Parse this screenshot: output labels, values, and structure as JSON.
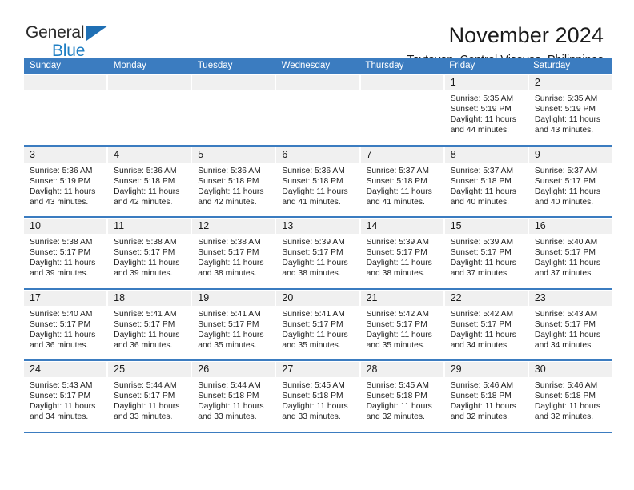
{
  "logo": {
    "word_one": "General",
    "word_two": "Blue",
    "triangle_color": "#1f6fb4",
    "blue_color": "#1f7fc4"
  },
  "header": {
    "month_title": "November 2024",
    "location": "Taytayan, Central Visayas, Philippines"
  },
  "theme": {
    "header_blue": "#3b7cc0",
    "day_band_gray": "#f0f0f0",
    "text_color": "#1a1a1a"
  },
  "weekdays": [
    "Sunday",
    "Monday",
    "Tuesday",
    "Wednesday",
    "Thursday",
    "Friday",
    "Saturday"
  ],
  "weeks": [
    [
      {
        "day": "",
        "sunrise": "",
        "sunset": "",
        "daylight_a": "",
        "daylight_b": "",
        "empty": true
      },
      {
        "day": "",
        "sunrise": "",
        "sunset": "",
        "daylight_a": "",
        "daylight_b": "",
        "empty": true
      },
      {
        "day": "",
        "sunrise": "",
        "sunset": "",
        "daylight_a": "",
        "daylight_b": "",
        "empty": true
      },
      {
        "day": "",
        "sunrise": "",
        "sunset": "",
        "daylight_a": "",
        "daylight_b": "",
        "empty": true
      },
      {
        "day": "",
        "sunrise": "",
        "sunset": "",
        "daylight_a": "",
        "daylight_b": "",
        "empty": true
      },
      {
        "day": "1",
        "sunrise": "Sunrise: 5:35 AM",
        "sunset": "Sunset: 5:19 PM",
        "daylight_a": "Daylight: 11 hours",
        "daylight_b": "and 44 minutes."
      },
      {
        "day": "2",
        "sunrise": "Sunrise: 5:35 AM",
        "sunset": "Sunset: 5:19 PM",
        "daylight_a": "Daylight: 11 hours",
        "daylight_b": "and 43 minutes."
      }
    ],
    [
      {
        "day": "3",
        "sunrise": "Sunrise: 5:36 AM",
        "sunset": "Sunset: 5:19 PM",
        "daylight_a": "Daylight: 11 hours",
        "daylight_b": "and 43 minutes."
      },
      {
        "day": "4",
        "sunrise": "Sunrise: 5:36 AM",
        "sunset": "Sunset: 5:18 PM",
        "daylight_a": "Daylight: 11 hours",
        "daylight_b": "and 42 minutes."
      },
      {
        "day": "5",
        "sunrise": "Sunrise: 5:36 AM",
        "sunset": "Sunset: 5:18 PM",
        "daylight_a": "Daylight: 11 hours",
        "daylight_b": "and 42 minutes."
      },
      {
        "day": "6",
        "sunrise": "Sunrise: 5:36 AM",
        "sunset": "Sunset: 5:18 PM",
        "daylight_a": "Daylight: 11 hours",
        "daylight_b": "and 41 minutes."
      },
      {
        "day": "7",
        "sunrise": "Sunrise: 5:37 AM",
        "sunset": "Sunset: 5:18 PM",
        "daylight_a": "Daylight: 11 hours",
        "daylight_b": "and 41 minutes."
      },
      {
        "day": "8",
        "sunrise": "Sunrise: 5:37 AM",
        "sunset": "Sunset: 5:18 PM",
        "daylight_a": "Daylight: 11 hours",
        "daylight_b": "and 40 minutes."
      },
      {
        "day": "9",
        "sunrise": "Sunrise: 5:37 AM",
        "sunset": "Sunset: 5:17 PM",
        "daylight_a": "Daylight: 11 hours",
        "daylight_b": "and 40 minutes."
      }
    ],
    [
      {
        "day": "10",
        "sunrise": "Sunrise: 5:38 AM",
        "sunset": "Sunset: 5:17 PM",
        "daylight_a": "Daylight: 11 hours",
        "daylight_b": "and 39 minutes."
      },
      {
        "day": "11",
        "sunrise": "Sunrise: 5:38 AM",
        "sunset": "Sunset: 5:17 PM",
        "daylight_a": "Daylight: 11 hours",
        "daylight_b": "and 39 minutes."
      },
      {
        "day": "12",
        "sunrise": "Sunrise: 5:38 AM",
        "sunset": "Sunset: 5:17 PM",
        "daylight_a": "Daylight: 11 hours",
        "daylight_b": "and 38 minutes."
      },
      {
        "day": "13",
        "sunrise": "Sunrise: 5:39 AM",
        "sunset": "Sunset: 5:17 PM",
        "daylight_a": "Daylight: 11 hours",
        "daylight_b": "and 38 minutes."
      },
      {
        "day": "14",
        "sunrise": "Sunrise: 5:39 AM",
        "sunset": "Sunset: 5:17 PM",
        "daylight_a": "Daylight: 11 hours",
        "daylight_b": "and 38 minutes."
      },
      {
        "day": "15",
        "sunrise": "Sunrise: 5:39 AM",
        "sunset": "Sunset: 5:17 PM",
        "daylight_a": "Daylight: 11 hours",
        "daylight_b": "and 37 minutes."
      },
      {
        "day": "16",
        "sunrise": "Sunrise: 5:40 AM",
        "sunset": "Sunset: 5:17 PM",
        "daylight_a": "Daylight: 11 hours",
        "daylight_b": "and 37 minutes."
      }
    ],
    [
      {
        "day": "17",
        "sunrise": "Sunrise: 5:40 AM",
        "sunset": "Sunset: 5:17 PM",
        "daylight_a": "Daylight: 11 hours",
        "daylight_b": "and 36 minutes."
      },
      {
        "day": "18",
        "sunrise": "Sunrise: 5:41 AM",
        "sunset": "Sunset: 5:17 PM",
        "daylight_a": "Daylight: 11 hours",
        "daylight_b": "and 36 minutes."
      },
      {
        "day": "19",
        "sunrise": "Sunrise: 5:41 AM",
        "sunset": "Sunset: 5:17 PM",
        "daylight_a": "Daylight: 11 hours",
        "daylight_b": "and 35 minutes."
      },
      {
        "day": "20",
        "sunrise": "Sunrise: 5:41 AM",
        "sunset": "Sunset: 5:17 PM",
        "daylight_a": "Daylight: 11 hours",
        "daylight_b": "and 35 minutes."
      },
      {
        "day": "21",
        "sunrise": "Sunrise: 5:42 AM",
        "sunset": "Sunset: 5:17 PM",
        "daylight_a": "Daylight: 11 hours",
        "daylight_b": "and 35 minutes."
      },
      {
        "day": "22",
        "sunrise": "Sunrise: 5:42 AM",
        "sunset": "Sunset: 5:17 PM",
        "daylight_a": "Daylight: 11 hours",
        "daylight_b": "and 34 minutes."
      },
      {
        "day": "23",
        "sunrise": "Sunrise: 5:43 AM",
        "sunset": "Sunset: 5:17 PM",
        "daylight_a": "Daylight: 11 hours",
        "daylight_b": "and 34 minutes."
      }
    ],
    [
      {
        "day": "24",
        "sunrise": "Sunrise: 5:43 AM",
        "sunset": "Sunset: 5:17 PM",
        "daylight_a": "Daylight: 11 hours",
        "daylight_b": "and 34 minutes."
      },
      {
        "day": "25",
        "sunrise": "Sunrise: 5:44 AM",
        "sunset": "Sunset: 5:17 PM",
        "daylight_a": "Daylight: 11 hours",
        "daylight_b": "and 33 minutes."
      },
      {
        "day": "26",
        "sunrise": "Sunrise: 5:44 AM",
        "sunset": "Sunset: 5:18 PM",
        "daylight_a": "Daylight: 11 hours",
        "daylight_b": "and 33 minutes."
      },
      {
        "day": "27",
        "sunrise": "Sunrise: 5:45 AM",
        "sunset": "Sunset: 5:18 PM",
        "daylight_a": "Daylight: 11 hours",
        "daylight_b": "and 33 minutes."
      },
      {
        "day": "28",
        "sunrise": "Sunrise: 5:45 AM",
        "sunset": "Sunset: 5:18 PM",
        "daylight_a": "Daylight: 11 hours",
        "daylight_b": "and 32 minutes."
      },
      {
        "day": "29",
        "sunrise": "Sunrise: 5:46 AM",
        "sunset": "Sunset: 5:18 PM",
        "daylight_a": "Daylight: 11 hours",
        "daylight_b": "and 32 minutes."
      },
      {
        "day": "30",
        "sunrise": "Sunrise: 5:46 AM",
        "sunset": "Sunset: 5:18 PM",
        "daylight_a": "Daylight: 11 hours",
        "daylight_b": "and 32 minutes."
      }
    ]
  ]
}
